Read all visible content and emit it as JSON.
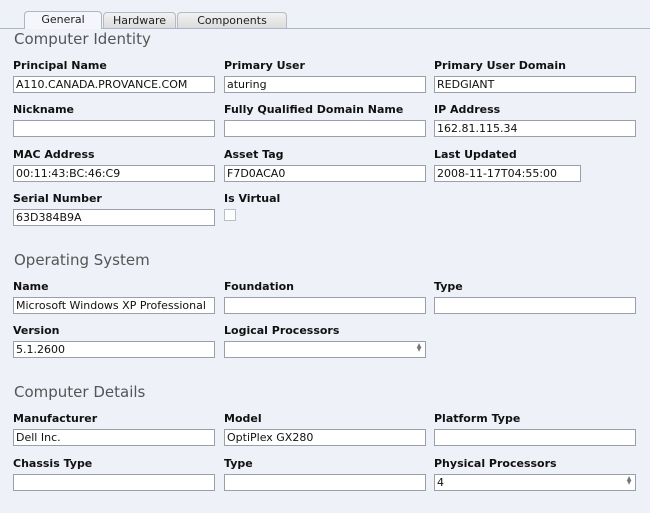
{
  "tabs": [
    "General",
    "Hardware",
    "Components"
  ],
  "sections": {
    "identity": {
      "title": "Computer Identity",
      "principal_name": {
        "label": "Principal Name",
        "value": "A110.CANADA.PROVANCE.COM"
      },
      "primary_user": {
        "label": "Primary User",
        "value": "aturing"
      },
      "primary_user_domain": {
        "label": "Primary User Domain",
        "value": "REDGIANT"
      },
      "nickname": {
        "label": "Nickname",
        "value": ""
      },
      "fqdn": {
        "label": "Fully Qualified Domain Name",
        "value": ""
      },
      "ip_address": {
        "label": "IP Address",
        "value": "162.81.115.34"
      },
      "mac_address": {
        "label": "MAC Address",
        "value": "00:11:43:BC:46:C9"
      },
      "asset_tag": {
        "label": "Asset Tag",
        "value": "F7D0ACA0"
      },
      "last_updated": {
        "label": "Last Updated",
        "value": "2008-11-17T04:55:00"
      },
      "serial_number": {
        "label": "Serial Number",
        "value": "63D384B9A"
      },
      "is_virtual": {
        "label": "Is Virtual",
        "checked": false
      }
    },
    "os": {
      "title": "Operating System",
      "name": {
        "label": "Name",
        "value": "Microsoft Windows XP Professional"
      },
      "foundation": {
        "label": "Foundation",
        "value": ""
      },
      "type": {
        "label": "Type",
        "value": ""
      },
      "version": {
        "label": "Version",
        "value": "5.1.2600"
      },
      "logical_processors": {
        "label": "Logical Processors",
        "value": ""
      }
    },
    "details": {
      "title": "Computer Details",
      "manufacturer": {
        "label": "Manufacturer",
        "value": "Dell Inc."
      },
      "model": {
        "label": "Model",
        "value": "OptiPlex GX280"
      },
      "platform_type": {
        "label": "Platform Type",
        "value": ""
      },
      "chassis_type": {
        "label": "Chassis Type",
        "value": ""
      },
      "type": {
        "label": "Type",
        "value": ""
      },
      "physical_processors": {
        "label": "Physical Processors",
        "value": "4"
      }
    }
  }
}
